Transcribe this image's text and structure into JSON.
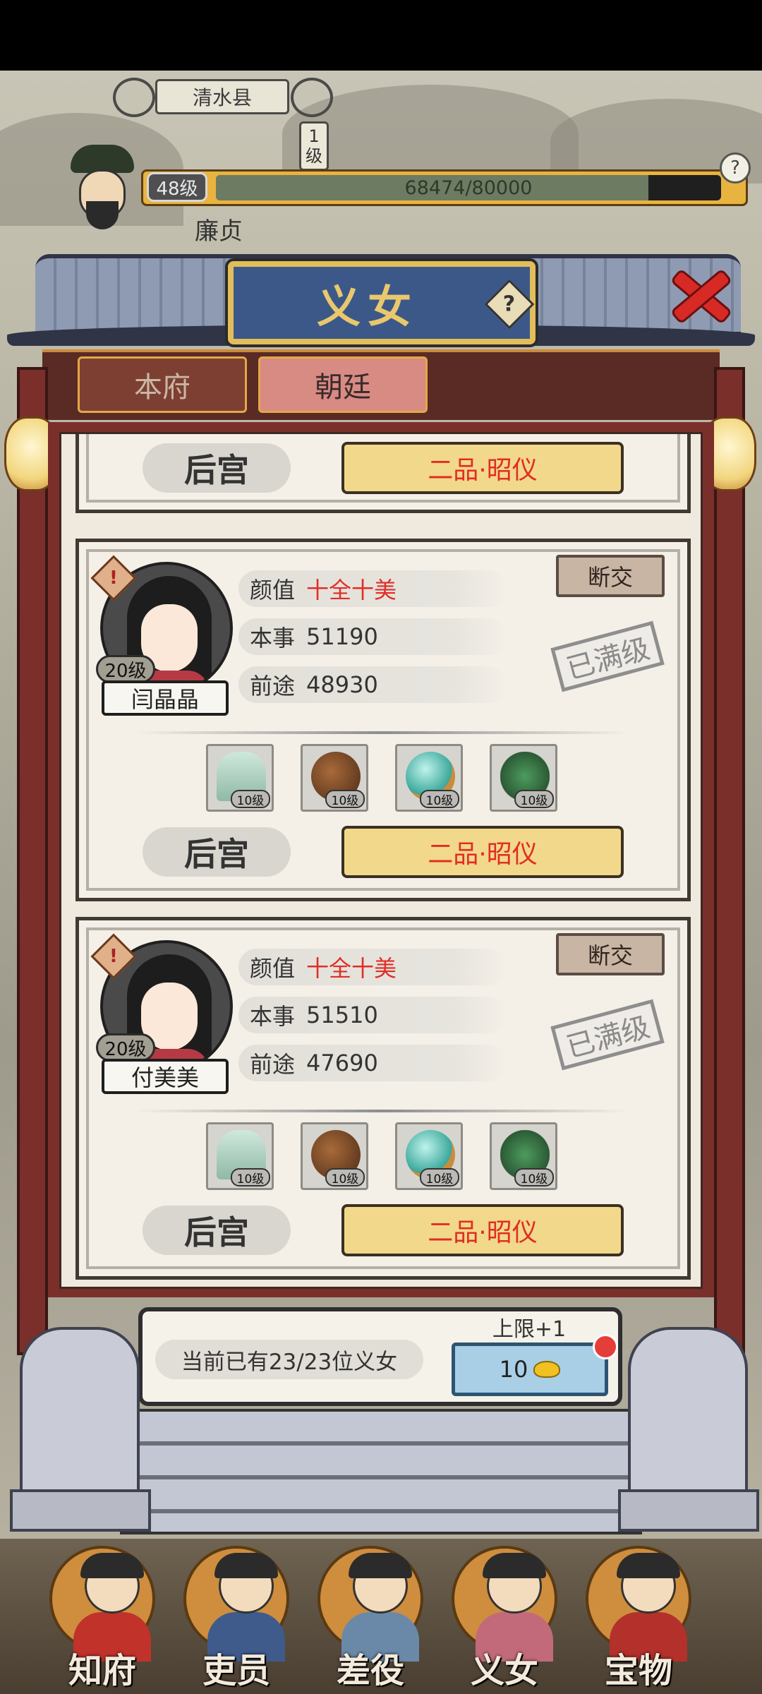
{
  "county": {
    "name": "清水县",
    "level_num": "1",
    "level_unit": "级"
  },
  "player": {
    "level": "48级",
    "exp_text": "68474/80000",
    "exp_fraction": 0.8559,
    "name": "廉贞"
  },
  "dialog": {
    "title": "义女",
    "help_icon": "question-icon",
    "close_icon": "close-x-icon",
    "tabs": [
      {
        "label": "本府",
        "active": false
      },
      {
        "label": "朝廷",
        "active": true
      }
    ]
  },
  "top_partial_card": {
    "palace": "后宫",
    "rank": "二品·昭仪"
  },
  "daughters": [
    {
      "name": "闫晶晶",
      "level": "20级",
      "beauty_label": "颜值",
      "beauty_value": "十全十美",
      "ability_label": "本事",
      "ability_value": "51190",
      "prospect_label": "前途",
      "prospect_value": "48930",
      "sever_label": "断交",
      "max_stamp": "已满级",
      "items": [
        {
          "icon": "jade-robe-icon",
          "level": "10级"
        },
        {
          "icon": "bronze-bell-icon",
          "level": "10级"
        },
        {
          "icon": "jade-orb-icon",
          "level": "10级"
        },
        {
          "icon": "jade-tree-icon",
          "level": "10级"
        }
      ],
      "palace": "后宫",
      "rank": "二品·昭仪"
    },
    {
      "name": "付美美",
      "level": "20级",
      "beauty_label": "颜值",
      "beauty_value": "十全十美",
      "ability_label": "本事",
      "ability_value": "51510",
      "prospect_label": "前途",
      "prospect_value": "47690",
      "sever_label": "断交",
      "max_stamp": "已满级",
      "items": [
        {
          "icon": "jade-robe-icon",
          "level": "10级"
        },
        {
          "icon": "bronze-bell-icon",
          "level": "10级"
        },
        {
          "icon": "jade-orb-icon",
          "level": "10级"
        },
        {
          "icon": "jade-tree-icon",
          "level": "10级"
        }
      ],
      "palace": "后宫",
      "rank": "二品·昭仪"
    }
  ],
  "footer": {
    "count_text": "当前已有23/23位义女",
    "limit_label": "上限+1",
    "buy_cost": "10",
    "currency_icon": "gold-ingot-icon"
  },
  "nav": [
    {
      "label": "知府",
      "icon": "magistrate-icon",
      "color": "#c0322a"
    },
    {
      "label": "吏员",
      "icon": "clerk-icon",
      "color": "#3e5b8c"
    },
    {
      "label": "差役",
      "icon": "constable-icon",
      "color": "#6a89a8"
    },
    {
      "label": "义女",
      "icon": "daughter-icon",
      "color": "#c26a7a"
    },
    {
      "label": "宝物",
      "icon": "treasure-bag-icon",
      "color": "#b3302b"
    }
  ],
  "colors": {
    "rank_text": "#e02e25",
    "plaque": "#3c5889",
    "gold_trim": "#e2bd5b",
    "pillar": "#7a2f2a"
  }
}
